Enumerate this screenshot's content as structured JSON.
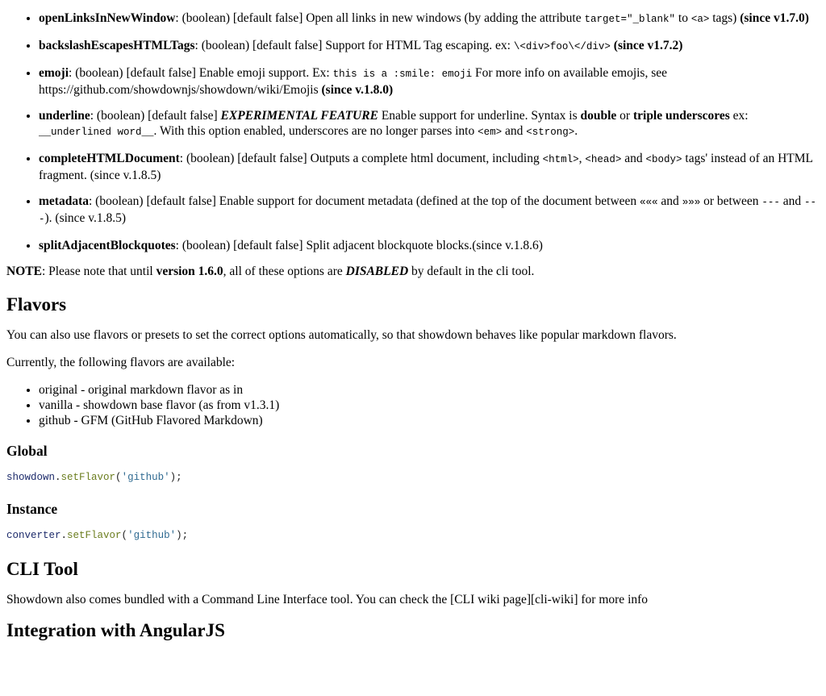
{
  "options": [
    {
      "name": "openLinksInNewWindow",
      "text1": ": (boolean) [default false] Open all links in new windows (by adding the attribute ",
      "code1": "target=\"_blank\"",
      "text2": " to ",
      "code2": "<a>",
      "text3": " tags) ",
      "since": "(since v1.7.0)"
    },
    {
      "name": "backslashEscapesHTMLTags",
      "text1": ": (boolean) [default false] Support for HTML Tag escaping. ex: ",
      "code1": "\\<div>foo\\</div>",
      "text2": " ",
      "since": "(since v1.7.2)"
    },
    {
      "name": "emoji",
      "text1": ": (boolean) [default false] Enable emoji support. Ex: ",
      "code1": "this is a :smile: emoji",
      "text2": " For more info on available emojis, see https://github.com/showdownjs/showdown/wiki/Emojis ",
      "since": "(since v.1.8.0)"
    },
    {
      "name": "underline",
      "text1": ": (boolean) [default false] ",
      "exp": "EXPERIMENTAL FEATURE",
      "text2": " Enable support for underline. Syntax is ",
      "b1": "double",
      "text3": " or ",
      "b2": "triple underscores",
      "text4": " ex: ",
      "code1": "__underlined word__",
      "text5": ". With this option enabled, underscores are no longer parses into ",
      "code2": "<em>",
      "text6": " and ",
      "code3": "<strong>",
      "text7": "."
    },
    {
      "name": "completeHTMLDocument",
      "text1": ": (boolean) [default false] Outputs a complete html document, including ",
      "code1": "<html>",
      "text2": ", ",
      "code2": "<head>",
      "text3": " and ",
      "code3": "<body>",
      "text4": " tags' instead of an HTML fragment. (since v.1.8.5)"
    },
    {
      "name": "metadata",
      "text1": ": (boolean) [default false] Enable support for document metadata (defined at the top of the document between ",
      "code1": "«««",
      "text2": " and ",
      "code2": "»»»",
      "text3": " or between ",
      "code3": "---",
      "text4": " and ",
      "code4": "---",
      "text5": "). (since v.1.8.5)"
    },
    {
      "name": "splitAdjacentBlockquotes",
      "text1": ": (boolean) [default false] Split adjacent blockquote blocks.(since v.1.8.6)"
    }
  ],
  "note": {
    "label": "NOTE",
    "text1": ": Please note that until ",
    "version": "version 1.6.0",
    "text2": ", all of these options are ",
    "disabled": "DISABLED",
    "text3": " by default in the cli tool."
  },
  "flavors": {
    "heading": "Flavors",
    "intro": "You can also use flavors or presets to set the correct options automatically, so that showdown behaves like popular markdown flavors.",
    "currently": "Currently, the following flavors are available:",
    "items": [
      "original - original markdown flavor as in",
      "vanilla - showdown base flavor (as from v1.3.1)",
      "github - GFM (GitHub Flavored Markdown)"
    ],
    "global_heading": "Global",
    "global_code": {
      "obj": "showdown",
      "dot": ".",
      "fn": "setFlavor",
      "open": "(",
      "arg": "'github'",
      "close": ");"
    },
    "instance_heading": "Instance",
    "instance_code": {
      "obj": "converter",
      "dot": ".",
      "fn": "setFlavor",
      "open": "(",
      "arg": "'github'",
      "close": ");"
    }
  },
  "cli": {
    "heading": "CLI Tool",
    "text": "Showdown also comes bundled with a Command Line Interface tool. You can check the [CLI wiki page][cli-wiki] for more info"
  },
  "angular": {
    "heading": "Integration with AngularJS"
  },
  "colors": {
    "code_var": "#1d2b6b",
    "code_fn": "#6b7d1e",
    "code_str": "#2f6a91"
  }
}
